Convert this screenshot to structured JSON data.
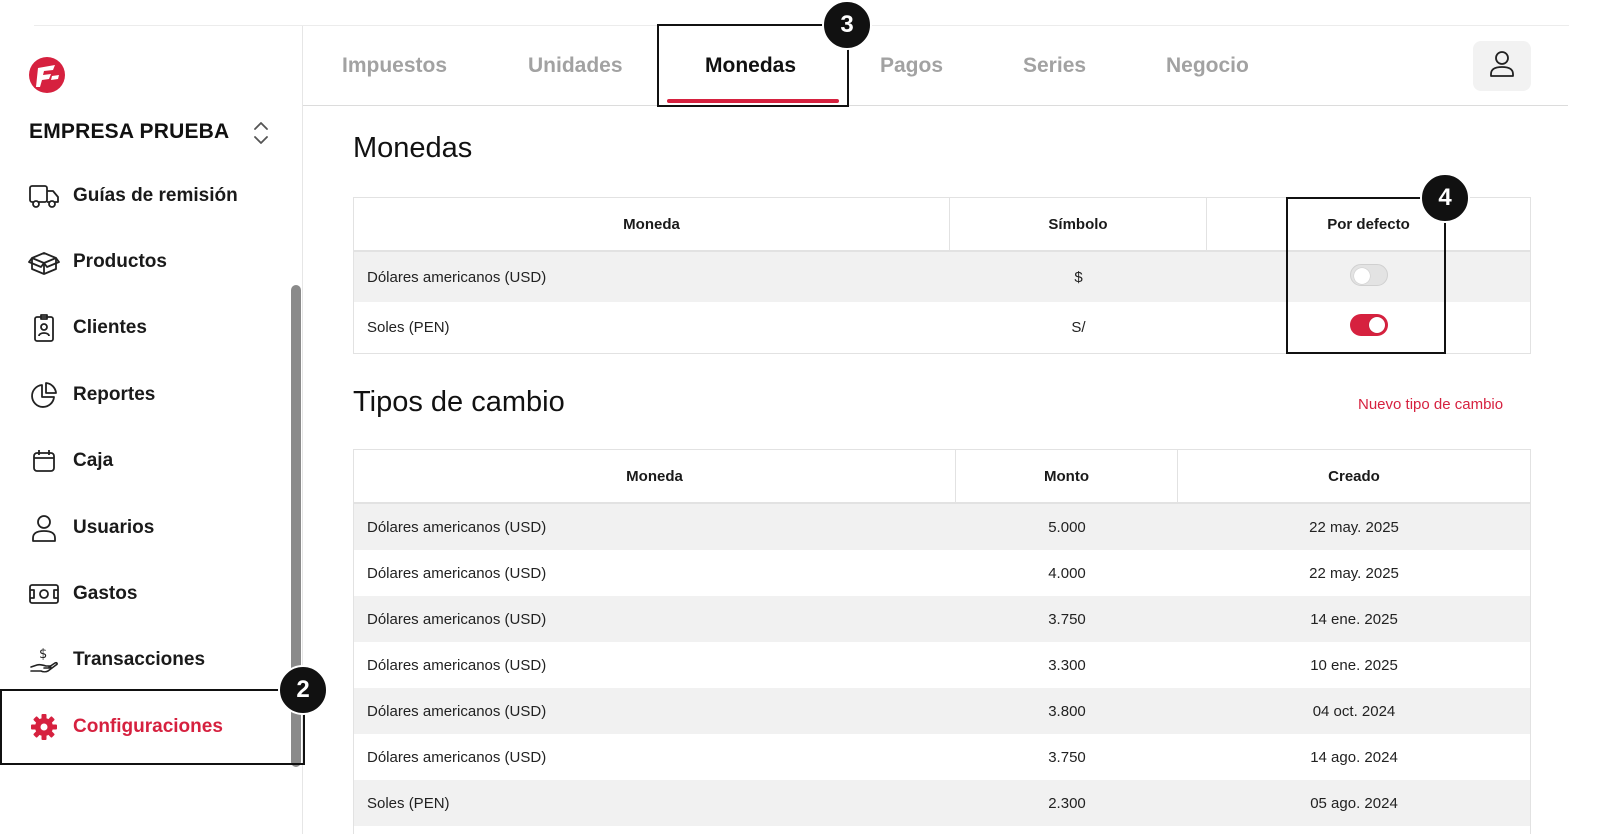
{
  "company": {
    "name": "EMPRESA PRUEBA"
  },
  "colors": {
    "accent": "#d6213f",
    "inactive_tab": "#a2a2a2"
  },
  "sidebar": {
    "items": [
      {
        "label": "Guías de remisión",
        "icon": "truck-icon"
      },
      {
        "label": "Productos",
        "icon": "box-icon"
      },
      {
        "label": "Clientes",
        "icon": "id-badge-icon"
      },
      {
        "label": "Reportes",
        "icon": "pie-chart-icon"
      },
      {
        "label": "Caja",
        "icon": "cash-register-icon"
      },
      {
        "label": "Usuarios",
        "icon": "user-icon"
      },
      {
        "label": "Gastos",
        "icon": "banknote-icon"
      },
      {
        "label": "Transacciones",
        "icon": "hand-dollar-icon"
      },
      {
        "label": "Configuraciones",
        "icon": "gear-icon",
        "active": true
      }
    ]
  },
  "annotations": {
    "a2": "2",
    "a3": "3",
    "a4": "4"
  },
  "tabs": [
    {
      "label": "Impuestos"
    },
    {
      "label": "Unidades"
    },
    {
      "label": "Monedas",
      "active": true
    },
    {
      "label": "Pagos"
    },
    {
      "label": "Series"
    },
    {
      "label": "Negocio"
    }
  ],
  "monedas": {
    "title": "Monedas",
    "headers": [
      "Moneda",
      "Símbolo",
      "Por defecto"
    ],
    "rows": [
      {
        "moneda": "Dólares americanos (USD)",
        "simbolo": "$",
        "default": false
      },
      {
        "moneda": "Soles (PEN)",
        "simbolo": "S/",
        "default": true
      }
    ]
  },
  "tipos_cambio": {
    "title": "Tipos de cambio",
    "new_link": "Nuevo tipo de cambio",
    "headers": [
      "Moneda",
      "Monto",
      "Creado"
    ],
    "rows": [
      {
        "moneda": "Dólares americanos (USD)",
        "monto": "5.000",
        "creado": "22 may. 2025"
      },
      {
        "moneda": "Dólares americanos (USD)",
        "monto": "4.000",
        "creado": "22 may. 2025"
      },
      {
        "moneda": "Dólares americanos (USD)",
        "monto": "3.750",
        "creado": "14 ene. 2025"
      },
      {
        "moneda": "Dólares americanos (USD)",
        "monto": "3.300",
        "creado": "10 ene. 2025"
      },
      {
        "moneda": "Dólares americanos (USD)",
        "monto": "3.800",
        "creado": "04 oct. 2024"
      },
      {
        "moneda": "Dólares americanos (USD)",
        "monto": "3.750",
        "creado": "14 ago. 2024"
      },
      {
        "moneda": "Soles (PEN)",
        "monto": "2.300",
        "creado": "05 ago. 2024"
      }
    ]
  }
}
